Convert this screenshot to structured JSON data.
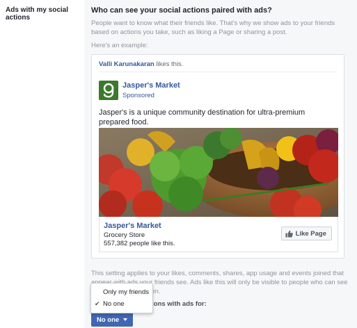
{
  "left": {
    "section_label": "Ads with my social actions"
  },
  "main": {
    "heading": "Who can see your social actions paired with ads?",
    "description": "People want to know what their friends like. That's why we show ads to your friends based on actions you take, such as liking a Page or sharing a post.",
    "example_label": "Here's an example:",
    "note": "This setting applies to your likes, comments, shares, app usage and events joined that appear with ads your friends see. Ads like this will only be visible to people who can see the action you've taken.",
    "pair_label": "Pair your social actions with ads for:"
  },
  "example_ad": {
    "friend_name": "Valli Karunakaran",
    "friend_action": " likes this.",
    "page_name": "Jasper's Market",
    "sponsored": "Sponsored",
    "ad_text": "Jasper's is a unique community destination for ultra-premium prepared food.",
    "link_title": "Jasper's Market",
    "link_category": "Grocery Store",
    "link_likes": "557,382 people like this.",
    "like_button": "Like Page",
    "logo_letter": "g",
    "icons": {
      "thumb": "thumbs-up-icon",
      "check": "checkmark-icon"
    }
  },
  "audience": {
    "selected_label": "No one",
    "options": [
      {
        "label": "Only my friends",
        "checked": false
      },
      {
        "label": "No one",
        "checked": true
      }
    ]
  },
  "colors": {
    "accent": "#4267b2",
    "link": "#365899",
    "logo_green": "#3b7a2c"
  }
}
